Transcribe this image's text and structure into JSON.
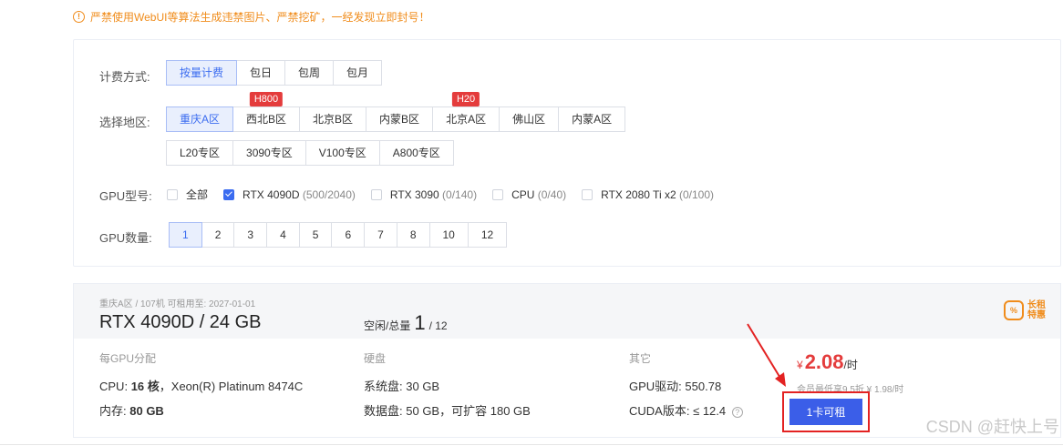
{
  "warning": {
    "text": "严禁使用WebUI等算法生成违禁图片、严禁挖矿，一经发现立即封号！"
  },
  "filters": {
    "billing": {
      "label": "计费方式:",
      "options": [
        "按量计费",
        "包日",
        "包周",
        "包月"
      ],
      "selected": "按量计费"
    },
    "region": {
      "label": "选择地区:",
      "row1": [
        "重庆A区",
        "西北B区",
        "北京B区",
        "内蒙B区",
        "北京A区",
        "佛山区",
        "内蒙A区"
      ],
      "row2": [
        "L20专区",
        "3090专区",
        "V100专区",
        "A800专区"
      ],
      "selected": "重庆A区",
      "badges": {
        "西北B区": "H800",
        "北京A区": "H20"
      }
    },
    "gpu_model": {
      "label": "GPU型号:",
      "options": [
        {
          "name": "全部",
          "meta": "",
          "checked": false
        },
        {
          "name": "RTX 4090D",
          "meta": "(500/2040)",
          "checked": true
        },
        {
          "name": "RTX 3090",
          "meta": "(0/140)",
          "checked": false
        },
        {
          "name": "CPU",
          "meta": "(0/40)",
          "checked": false
        },
        {
          "name": "RTX 2080 Ti x2",
          "meta": "(0/100)",
          "checked": false
        }
      ]
    },
    "gpu_count": {
      "label": "GPU数量:",
      "options": [
        "1",
        "2",
        "3",
        "4",
        "5",
        "6",
        "7",
        "8",
        "10",
        "12"
      ],
      "selected": "1"
    }
  },
  "card": {
    "subtitle": "重庆A区 / 107机  可租用至: 2027-01-01",
    "title": "RTX 4090D / 24 GB",
    "idle_label": "空闲/总量",
    "idle_free": "1",
    "idle_total": "/ 12",
    "promo_line1": "长租",
    "promo_line2": "特惠",
    "col1_header": "每GPU分配",
    "cpu_label": "CPU:",
    "cpu_cores": "16 核",
    "cpu_model": "Xeon(R) Platinum 8474C",
    "mem_label": "内存:",
    "mem_value": "80 GB",
    "col2_header": "硬盘",
    "sys_disk_label": "系统盘:",
    "sys_disk_value": "30 GB",
    "data_disk_label": "数据盘:",
    "data_disk_value": "50 GB",
    "data_disk_expand": "可扩容 180 GB",
    "col3_header": "其它",
    "driver_label": "GPU驱动:",
    "driver_value": "550.78",
    "cuda_label": "CUDA版本:",
    "cuda_value": "≤ 12.4",
    "price_currency": "¥",
    "price_value": "2.08",
    "price_unit": "/时",
    "member_text": "会员最低享9.5折 ¥ 1.98/时",
    "rent_button": "1卡可租"
  },
  "watermark": "CSDN @赶快上号",
  "colors": {
    "accent": "#3b6cf0",
    "warning": "#f08c1b",
    "badge": "#e43c3c",
    "button": "#3b5ee8",
    "highlight": "#e32222"
  }
}
